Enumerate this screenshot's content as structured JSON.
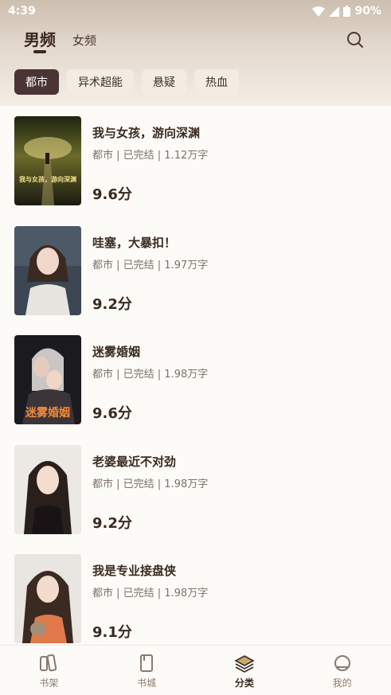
{
  "status": {
    "time": "4:39",
    "battery": "90%"
  },
  "header": {
    "tabs": [
      {
        "label": "男频"
      },
      {
        "label": "女频"
      }
    ]
  },
  "chips": [
    {
      "label": "都市"
    },
    {
      "label": "异术超能"
    },
    {
      "label": "悬疑"
    },
    {
      "label": "热血"
    }
  ],
  "books": [
    {
      "title": "我与女孩，游向深渊",
      "meta": "都市 | 已完结 | 1.12万字",
      "score": "9.6分",
      "cover_text": "我与女孩，游向深渊"
    },
    {
      "title": "哇塞，大暴扣！",
      "meta": "都市 | 已完结 | 1.97万字",
      "score": "9.2分"
    },
    {
      "title": "迷雾婚姻",
      "meta": "都市 | 已完结 | 1.98万字",
      "score": "9.6分",
      "cover_text": "迷雾婚姻"
    },
    {
      "title": "老婆最近不对劲",
      "meta": "都市 | 已完结 | 1.98万字",
      "score": "9.2分"
    },
    {
      "title": "我是专业接盘侠",
      "meta": "都市 | 已完结 | 1.98万字",
      "score": "9.1分"
    }
  ],
  "nav": [
    {
      "label": "书架",
      "icon": "bookshelf-icon"
    },
    {
      "label": "书城",
      "icon": "book-icon"
    },
    {
      "label": "分类",
      "icon": "layers-icon"
    },
    {
      "label": "我的",
      "icon": "profile-icon"
    }
  ],
  "colors": {
    "accent": "#4b3434",
    "background": "#fdfbf7"
  }
}
